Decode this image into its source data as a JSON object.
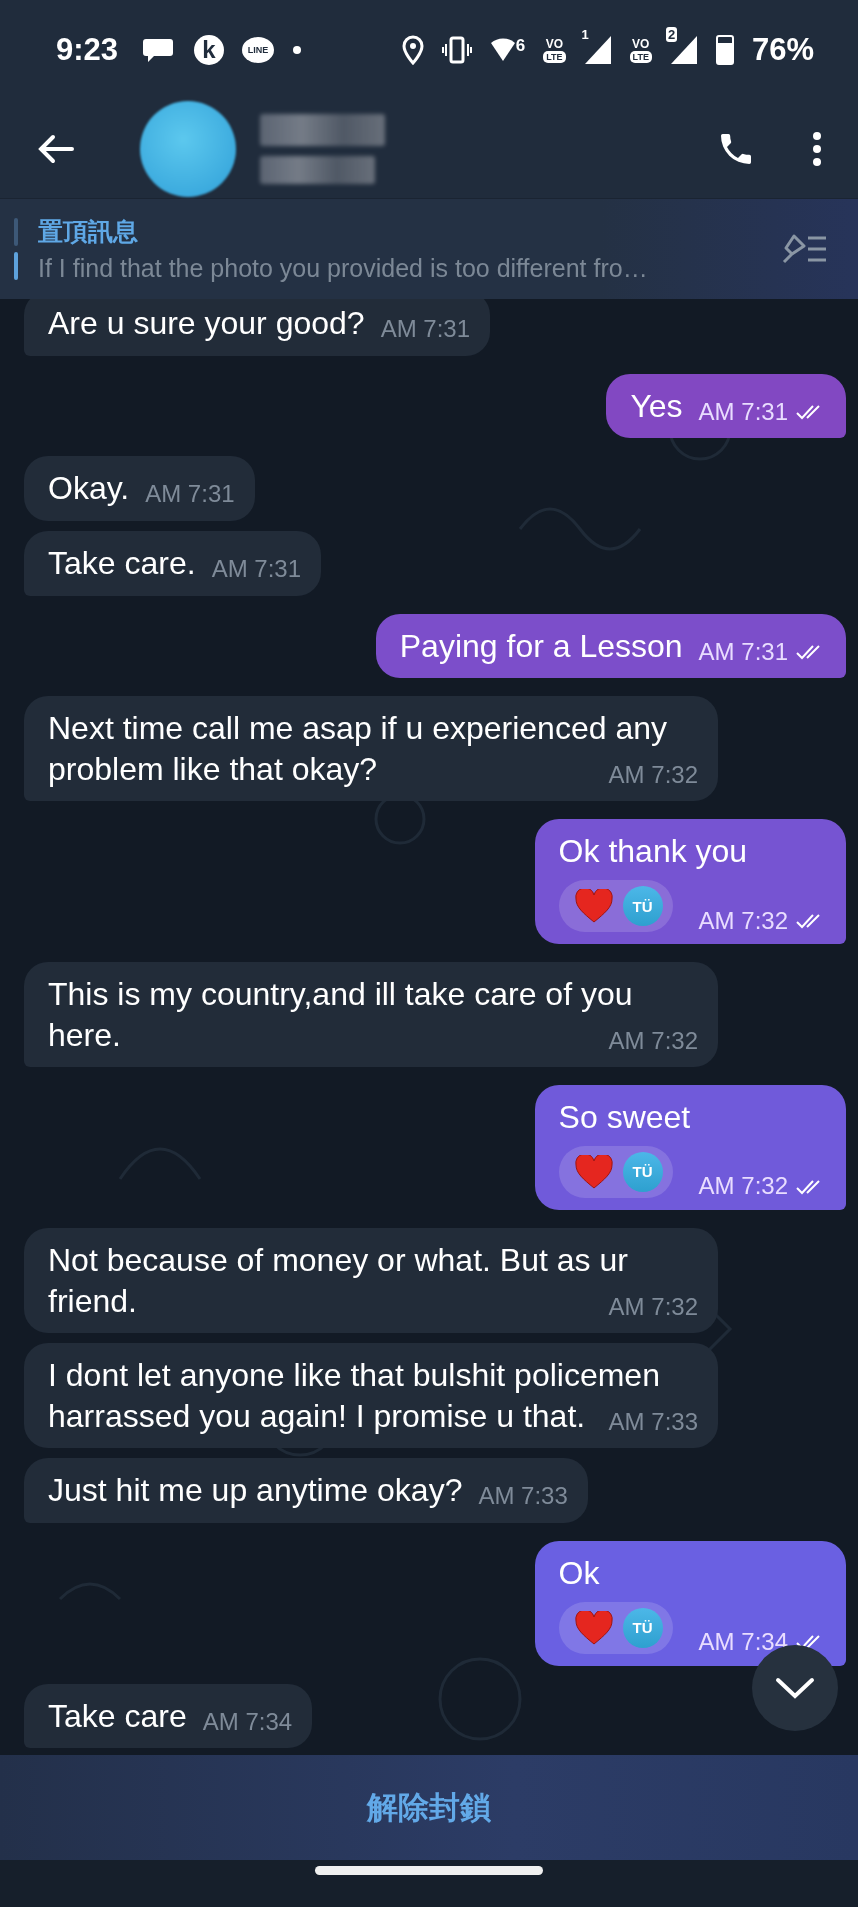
{
  "status_bar": {
    "time": "9:23",
    "notifications": [
      {
        "kind": "chat"
      },
      {
        "kind": "letter",
        "glyph": "k"
      },
      {
        "kind": "bubble",
        "glyph": "LINE"
      },
      {
        "kind": "dot"
      }
    ],
    "wifi_label": "6",
    "sims": [
      {
        "vo": "VO",
        "lte": "LTE",
        "slot": "1"
      },
      {
        "vo": "VO",
        "lte": "LTE",
        "slot": "2"
      }
    ],
    "battery": "76%"
  },
  "pinned": {
    "title": "置頂訊息",
    "text": "If I find that the photo you provided is too different fro…"
  },
  "messages": [
    {
      "kind": "incoming",
      "text": "Are u sure your good?",
      "time": "AM 7:31"
    },
    {
      "kind": "outgoing",
      "text": "Yes",
      "time": "AM 7:31",
      "read": true
    },
    {
      "kind": "incoming",
      "text": "Okay.",
      "time": "AM 7:31"
    },
    {
      "kind": "incoming",
      "text": "Take care.",
      "time": "AM 7:31"
    },
    {
      "kind": "outgoing",
      "text": "Paying for a Lesson",
      "time": "AM 7:31",
      "read": true
    },
    {
      "kind": "incoming",
      "text": "Next time call me asap if u experienced any problem like that okay?",
      "time": "AM 7:32"
    },
    {
      "kind": "outgoing",
      "text": "Ok thank you",
      "time": "AM 7:32",
      "read": true,
      "reaction": {
        "initials": "TÜ"
      }
    },
    {
      "kind": "incoming",
      "text": "This is my country,and ill take care of you here.",
      "time": "AM 7:32"
    },
    {
      "kind": "outgoing",
      "text": "So sweet",
      "time": "AM 7:32",
      "read": true,
      "reaction": {
        "initials": "TÜ"
      }
    },
    {
      "kind": "incoming",
      "text": "Not because of money or what. But as ur friend.",
      "time": "AM 7:32"
    },
    {
      "kind": "incoming",
      "text": "I dont let anyone like that bulshit policemen harrassed you again! I promise u that.",
      "time": "AM 7:33"
    },
    {
      "kind": "incoming",
      "text": "Just hit me up anytime okay?",
      "time": "AM 7:33"
    },
    {
      "kind": "outgoing",
      "text": "Ok",
      "time": "AM 7:34",
      "read": true,
      "reaction": {
        "initials": "TÜ"
      }
    },
    {
      "kind": "incoming",
      "text": "Take care",
      "time": "AM 7:34"
    }
  ],
  "unblock_button": "解除封鎖"
}
